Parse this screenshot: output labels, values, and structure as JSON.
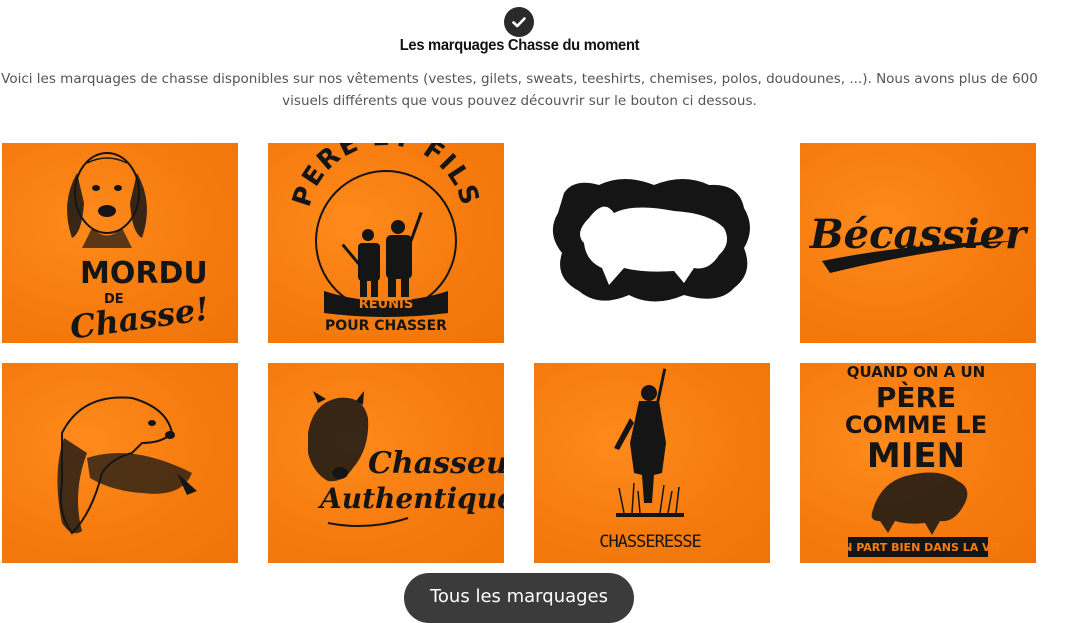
{
  "section": {
    "title": "Les marquages Chasse du moment",
    "description": "Voici les marquages de chasse disponibles sur nos vêtements (vestes, gilets, sweats, teeshirts, chemises, polos, doudounes, ...). Nous avons plus de 600 visuels différents que vous pouvez découvrir sur le bouton ci dessous.",
    "icon": "check-circle-icon"
  },
  "colors": {
    "tile_orange": "#f67e11",
    "button_bg": "#3b3b3b",
    "ink": "#151515"
  },
  "designs": [
    {
      "name": "mordu-de-chasse",
      "lines": [
        "MORDU",
        "DE",
        "Chasse!"
      ]
    },
    {
      "name": "pere-et-fils",
      "lines": [
        "PERE ET FILS",
        "REUNIS",
        "POUR CHASSER"
      ]
    },
    {
      "name": "running-boar-silhouette",
      "lines": []
    },
    {
      "name": "becassier",
      "lines": [
        "Bécassier"
      ]
    },
    {
      "name": "spaniel-with-bird",
      "lines": []
    },
    {
      "name": "chasseur-authentique",
      "lines": [
        "Chasseur",
        "Authentique"
      ]
    },
    {
      "name": "chasseresse",
      "lines": [
        "CHASSERESSE"
      ]
    },
    {
      "name": "quand-on-a-un-pere",
      "lines": [
        "QUAND ON A UN",
        "PÈRE",
        "COMME LE",
        "MIEN",
        "ON PART BIEN DANS LA VIE"
      ]
    }
  ],
  "cta": {
    "label": "Tous les marquages"
  }
}
